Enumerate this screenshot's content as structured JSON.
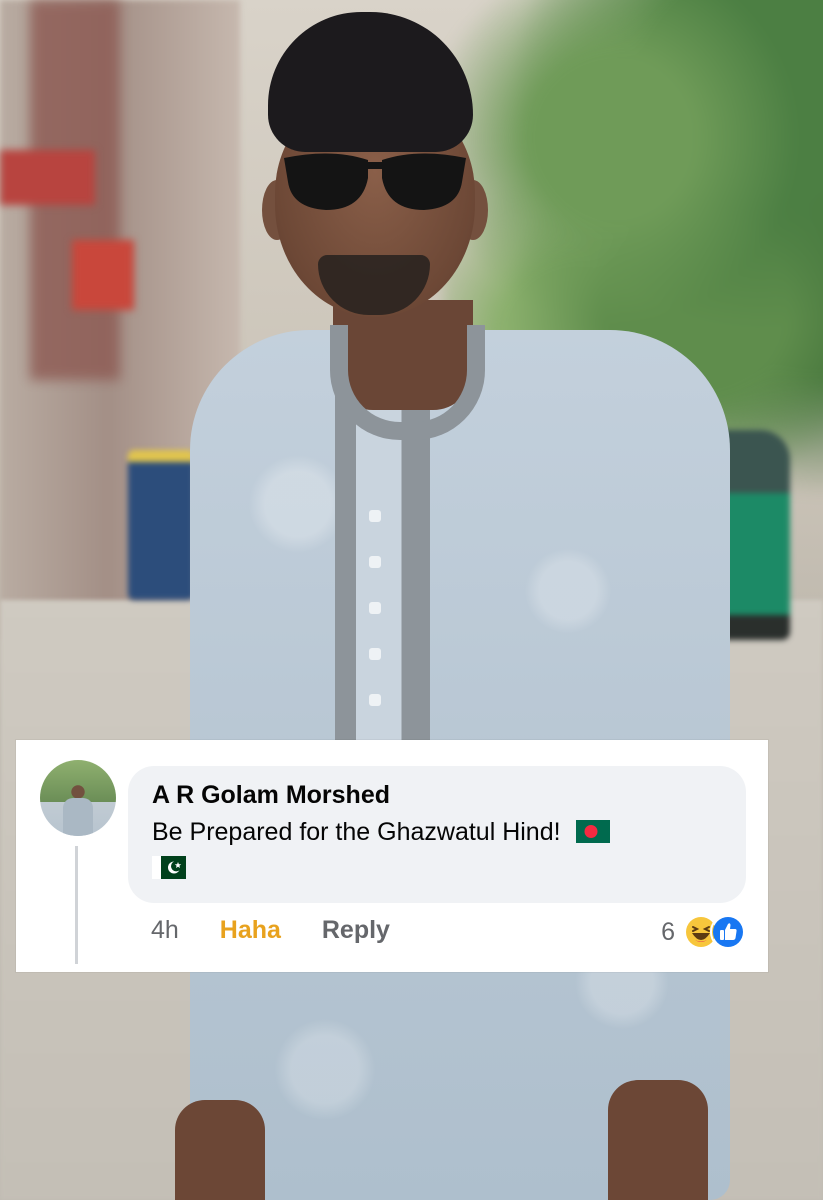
{
  "comment": {
    "author": "A R Golam Morshed",
    "text": "Be Prepared for the Ghazwatul Hind!",
    "flags": [
      "flag-bangladesh",
      "flag-pakistan"
    ],
    "time": "4h",
    "reaction_label": "Haha",
    "reply_label": "Reply",
    "reaction_count": "6",
    "reaction_icons": [
      "haha-emoji-icon",
      "like-thumb-icon"
    ]
  },
  "colors": {
    "bubble": "#f0f2f5",
    "haha": "#e8a21e",
    "meta": "#65676b",
    "like_blue": "#1877f2"
  }
}
